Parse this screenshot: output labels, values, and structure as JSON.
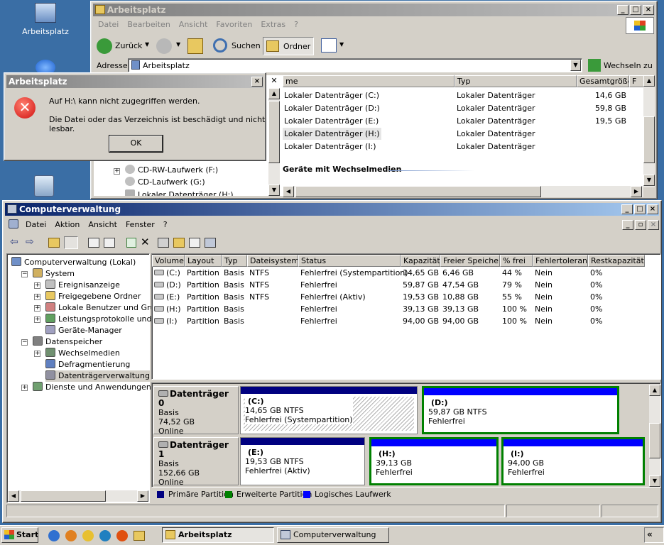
{
  "desktop": {
    "icon_label": "Arbeitsplatz"
  },
  "explorer": {
    "title": "Arbeitsplatz",
    "menu": [
      "Datei",
      "Bearbeiten",
      "Ansicht",
      "Favoriten",
      "Extras",
      "?"
    ],
    "toolbar": {
      "back": "Zurück",
      "search": "Suchen",
      "folders": "Ordner"
    },
    "address_label": "Adresse",
    "address_value": "Arbeitsplatz",
    "go_label": "Wechseln zu",
    "columns": [
      "me",
      "Typ",
      "Gesamtgröße",
      "F"
    ],
    "rows": [
      {
        "name": "Lokaler Datenträger (C:)",
        "type": "Lokaler Datenträger",
        "size": "14,6 GB"
      },
      {
        "name": "Lokaler Datenträger (D:)",
        "type": "Lokaler Datenträger",
        "size": "59,8 GB"
      },
      {
        "name": "Lokaler Datenträger (E:)",
        "type": "Lokaler Datenträger",
        "size": "19,5 GB"
      },
      {
        "name": "Lokaler Datenträger (H:)",
        "type": "Lokaler Datenträger",
        "size": ""
      },
      {
        "name": "Lokaler Datenträger (I:)",
        "type": "Lokaler Datenträger",
        "size": ""
      }
    ],
    "group_label": "Geräte mit Wechselmedien",
    "tree": [
      "CD-RW-Laufwerk (F:)",
      "CD-Laufwerk (G:)",
      "Lokaler Datenträger (H:)"
    ]
  },
  "dialog": {
    "title": "Arbeitsplatz",
    "line1": "Auf H:\\ kann nicht zugegriffen werden.",
    "line2": "Die Datei oder das Verzeichnis ist beschädigt und nicht lesbar.",
    "ok": "OK"
  },
  "mgmt": {
    "title": "Computerverwaltung",
    "menu": [
      "Datei",
      "Aktion",
      "Ansicht",
      "Fenster",
      "?"
    ],
    "tree": [
      {
        "label": "Computerverwaltung (Lokal)",
        "level": 0,
        "box": ""
      },
      {
        "label": "System",
        "level": 1,
        "box": "−"
      },
      {
        "label": "Ereignisanzeige",
        "level": 2,
        "box": "+"
      },
      {
        "label": "Freigegebene Ordner",
        "level": 2,
        "box": "+"
      },
      {
        "label": "Lokale Benutzer und Gruppe",
        "level": 2,
        "box": "+"
      },
      {
        "label": "Leistungsprotokolle und War",
        "level": 2,
        "box": "+"
      },
      {
        "label": "Geräte-Manager",
        "level": 2,
        "box": ""
      },
      {
        "label": "Datenspeicher",
        "level": 1,
        "box": "−"
      },
      {
        "label": "Wechselmedien",
        "level": 2,
        "box": "+"
      },
      {
        "label": "Defragmentierung",
        "level": 2,
        "box": ""
      },
      {
        "label": "Datenträgerverwaltung",
        "level": 2,
        "box": ""
      },
      {
        "label": "Dienste und Anwendungen",
        "level": 1,
        "box": "+"
      }
    ],
    "columns": [
      "Volume",
      "Layout",
      "Typ",
      "Dateisystem",
      "Status",
      "Kapazität",
      "Freier Speicher",
      "% frei",
      "Fehlertoleranz",
      "Restkapazität"
    ],
    "volumes": [
      [
        "(C:)",
        "Partition",
        "Basis",
        "NTFS",
        "Fehlerfrei (Systempartition)",
        "14,65 GB",
        "6,46 GB",
        "44 %",
        "Nein",
        "0%"
      ],
      [
        "(D:)",
        "Partition",
        "Basis",
        "NTFS",
        "Fehlerfrei",
        "59,87 GB",
        "47,54 GB",
        "79 %",
        "Nein",
        "0%"
      ],
      [
        "(E:)",
        "Partition",
        "Basis",
        "NTFS",
        "Fehlerfrei (Aktiv)",
        "19,53 GB",
        "10,88 GB",
        "55 %",
        "Nein",
        "0%"
      ],
      [
        "(H:)",
        "Partition",
        "Basis",
        "",
        "Fehlerfrei",
        "39,13 GB",
        "39,13 GB",
        "100 %",
        "Nein",
        "0%"
      ],
      [
        "(I:)",
        "Partition",
        "Basis",
        "",
        "Fehlerfrei",
        "94,00 GB",
        "94,00 GB",
        "100 %",
        "Nein",
        "0%"
      ]
    ],
    "disks": [
      {
        "name": "Datenträger 0",
        "type": "Basis",
        "size": "74,52 GB",
        "state": "Online",
        "parts": [
          {
            "label": "(C:)",
            "l2": "14,65 GB NTFS",
            "l3": "Fehlerfrei (Systempartition)"
          },
          {
            "label": "(D:)",
            "l2": "59,87 GB NTFS",
            "l3": "Fehlerfrei"
          }
        ]
      },
      {
        "name": "Datenträger 1",
        "type": "Basis",
        "size": "152,66 GB",
        "state": "Online",
        "parts": [
          {
            "label": "(E:)",
            "l2": "19,53 GB NTFS",
            "l3": "Fehlerfrei (Aktiv)"
          },
          {
            "label": "(H:)",
            "l2": "39,13 GB",
            "l3": "Fehlerfrei"
          },
          {
            "label": "(I:)",
            "l2": "94,00 GB",
            "l3": "Fehlerfrei"
          }
        ]
      }
    ],
    "legend": [
      "Primäre Partition",
      "Erweiterte Partition",
      "Logisches Laufwerk"
    ],
    "colors": {
      "primary": "#000080",
      "extended": "#008000",
      "logical": "#0000ff"
    }
  },
  "taskbar": {
    "start": "Start",
    "tasks": [
      "Arbeitsplatz",
      "Computerverwaltung"
    ],
    "tray": "«"
  }
}
